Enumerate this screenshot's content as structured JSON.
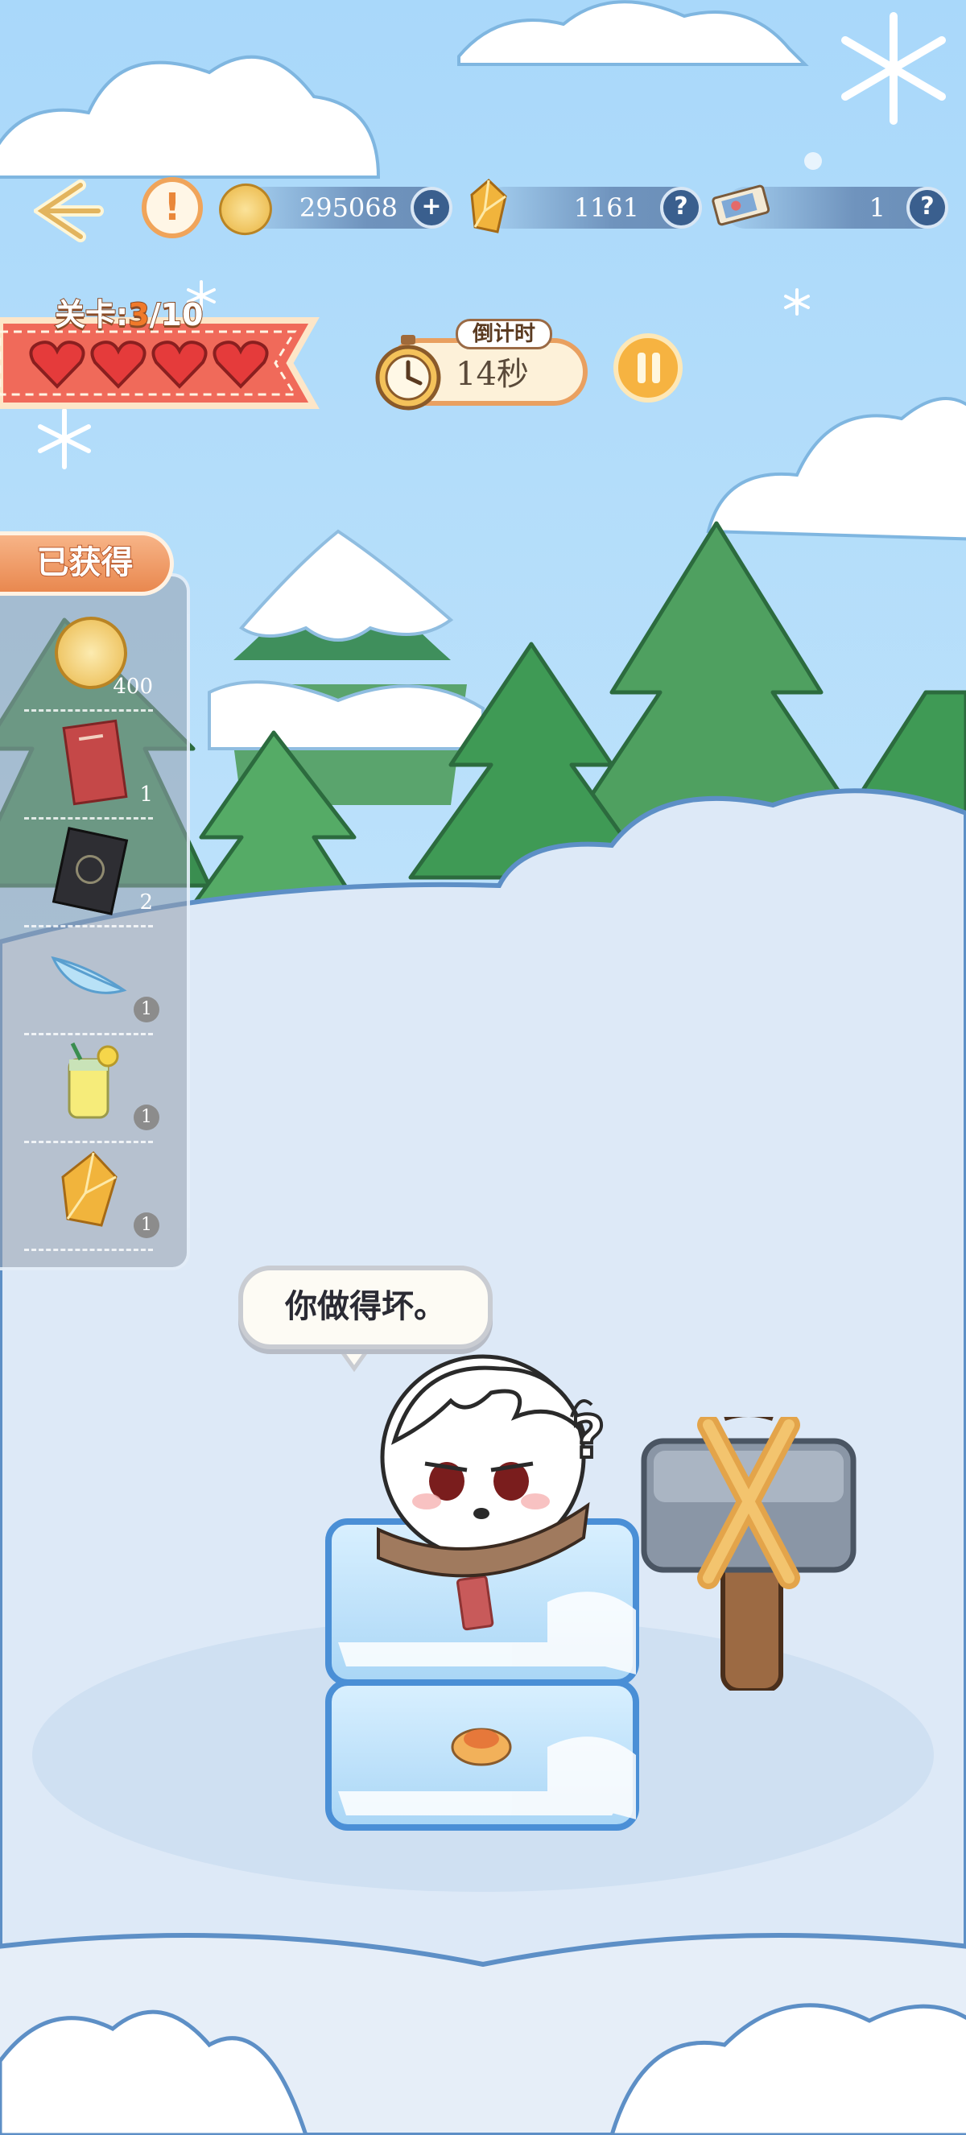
{
  "topbar": {
    "coins": "295068",
    "crystals": "1161",
    "tickets": "1",
    "plus_glyph": "+",
    "help_glyph": "?",
    "warn_glyph": "!"
  },
  "level": {
    "label": "关卡:",
    "current": "3",
    "total": "/10",
    "lives": 4
  },
  "timer": {
    "label": "倒计时",
    "value": "14秒"
  },
  "acquired": {
    "title": "已获得",
    "items": [
      {
        "icon": "gold-coin-icon",
        "count": "400"
      },
      {
        "icon": "red-book-icon",
        "count": "1"
      },
      {
        "icon": "black-card-icon",
        "count": "2"
      },
      {
        "icon": "feather-icon",
        "count": "1"
      },
      {
        "icon": "lemonade-icon",
        "count": "1"
      },
      {
        "icon": "amber-crystal-icon",
        "count": "1"
      }
    ]
  },
  "speech": "你做得坏。",
  "colors": {
    "sky": "#bfe3fb",
    "snow": "#dde9f7",
    "tree": "#3f9a55",
    "accent": "#e9884f"
  }
}
